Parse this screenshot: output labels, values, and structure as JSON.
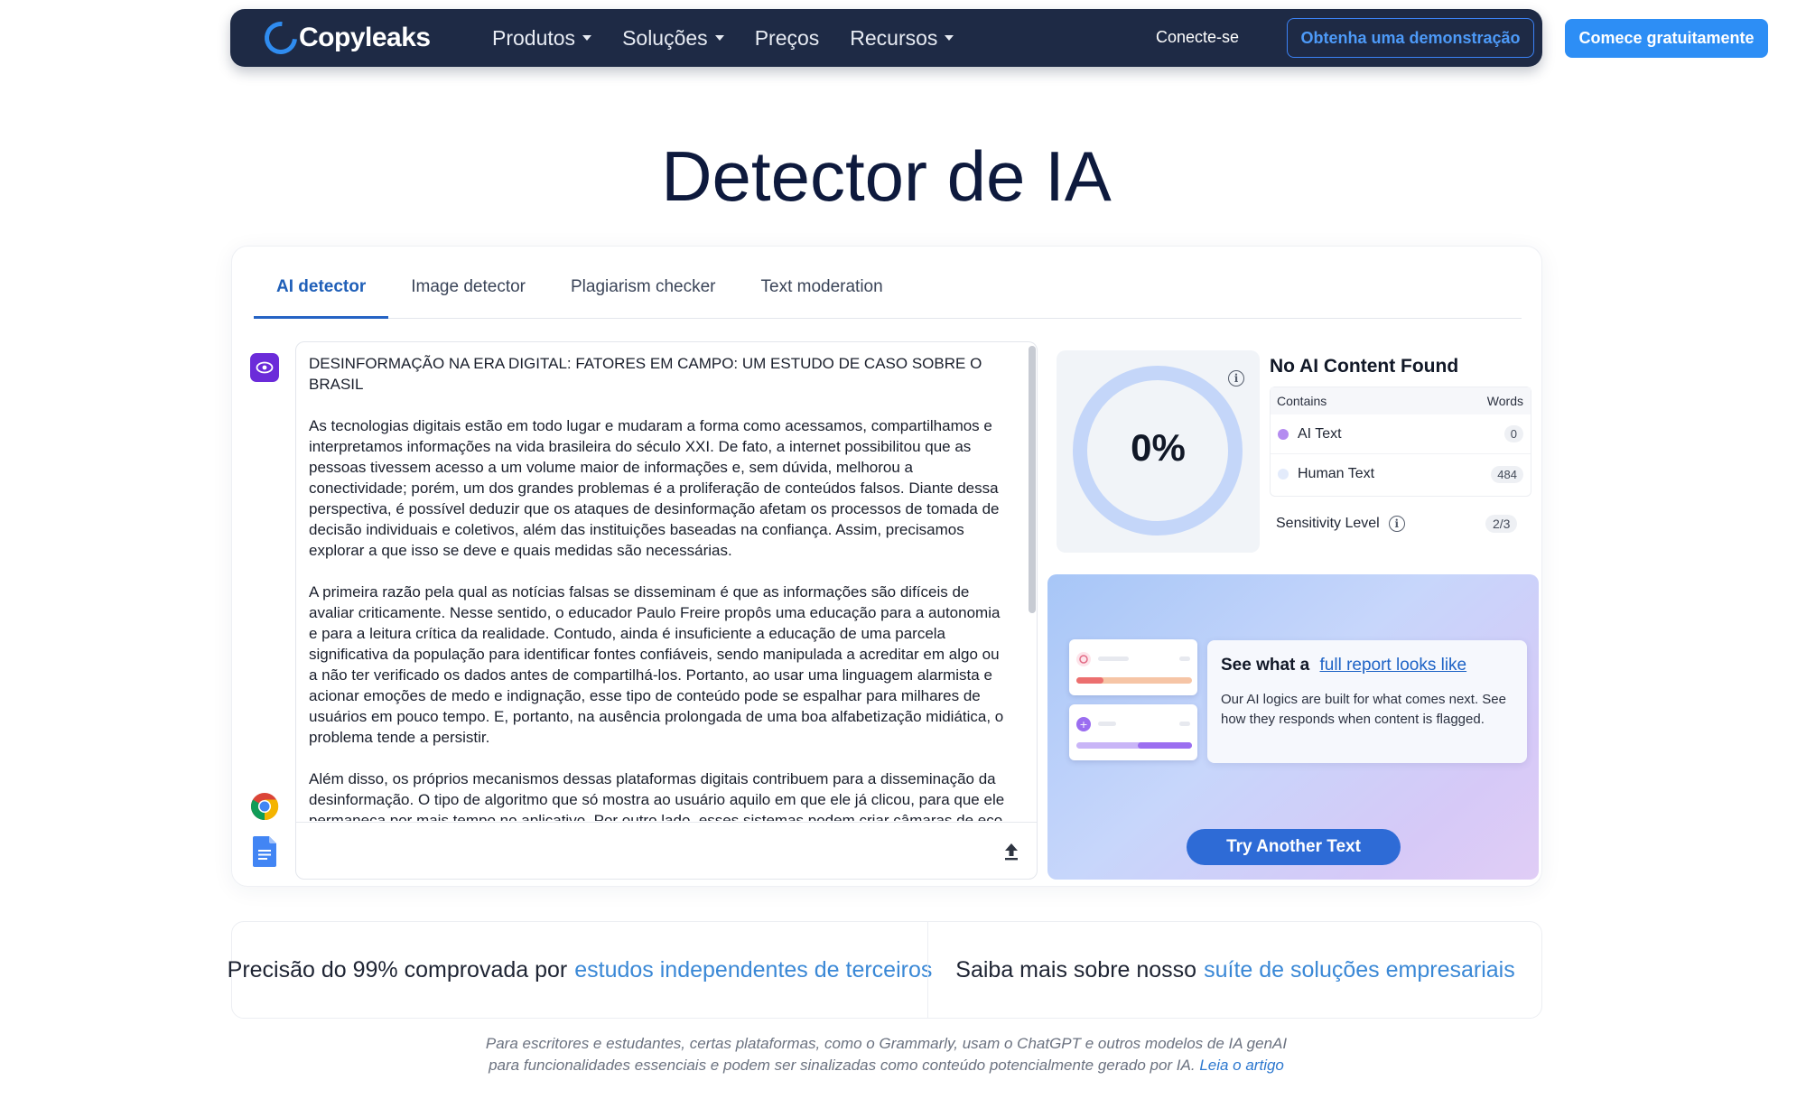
{
  "nav": {
    "logo": "Copyleaks",
    "menu": [
      {
        "label": "Produtos",
        "dropdown": true
      },
      {
        "label": "Soluções",
        "dropdown": true
      },
      {
        "label": "Preços",
        "dropdown": false
      },
      {
        "label": "Recursos",
        "dropdown": true
      }
    ],
    "login": "Conecte-se",
    "demo": "Obtenha uma demonstração",
    "start": "Comece gratuitamente"
  },
  "page_title": "Detector de IA",
  "tabs": [
    {
      "label": "AI detector",
      "active": true
    },
    {
      "label": "Image detector",
      "active": false
    },
    {
      "label": "Plagiarism checker",
      "active": false
    },
    {
      "label": "Text moderation",
      "active": false
    }
  ],
  "editor": {
    "paragraphs": [
      "DESINFORMAÇÃO NA ERA DIGITAL: FATORES EM CAMPO: UM ESTUDO DE CASO SOBRE O BRASIL",
      "As tecnologias digitais estão em todo lugar e mudaram a forma como acessamos, compartilhamos e interpretamos informações na vida brasileira do século XXI. De fato, a internet possibilitou que as pessoas tivessem acesso a um volume maior de informações e, sem dúvida, melhorou a conectividade; porém, um dos grandes problemas é a proliferação de conteúdos falsos. Diante dessa perspectiva, é possível deduzir que os ataques de desinformação afetam os processos de tomada de decisão individuais e coletivos, além das instituições baseadas na confiança. Assim, precisamos explorar a que isso se deve e quais medidas são necessárias.",
      "A primeira razão pela qual as notícias falsas se disseminam é que as informações são difíceis de avaliar criticamente. Nesse sentido, o educador Paulo Freire propôs uma educação para a autonomia e para a leitura crítica da realidade. Contudo, ainda é insuficiente a educação de uma parcela significativa da população para identificar fontes confiáveis, sendo manipulada a acreditar em algo ou a não ter verificado os dados antes de compartilhá-los. Portanto, ao usar uma linguagem alarmista e acionar emoções de medo e indignação, esse tipo de conteúdo pode se espalhar para milhares de usuários em pouco tempo. E, portanto, na ausência prolongada de uma boa alfabetização midiática, o problema tende a persistir.",
      "Além disso, os próprios mecanismos dessas plataformas digitais contribuem para a disseminação da desinformação. O tipo de algoritmo que só mostra ao usuário aquilo em que ele já clicou, para que ele permaneça por mais tempo no aplicativo. Por outro lado, esses sistemas podem criar câmaras de eco, nas quais certas mensagens são recicladas sem fim"
    ]
  },
  "result": {
    "percent": "0%",
    "title": "No AI Content Found",
    "table_headers": {
      "contains": "Contains",
      "words": "Words"
    },
    "rows": [
      {
        "label": "AI Text",
        "count": "0",
        "color": "#b48cf0"
      },
      {
        "label": "Human Text",
        "count": "484",
        "color": "#e3ebfb"
      }
    ],
    "sensitivity_label": "Sensitivity Level",
    "sensitivity_value": "2/3"
  },
  "promo": {
    "heading": "See what a",
    "link": "full report looks like",
    "body": "Our AI logics are built for what comes next. See how they responds when content is flagged.",
    "button": "Try Another Text"
  },
  "strip": {
    "left_text": "Precisão do 99% comprovada por",
    "left_link": "estudos independentes de terceiros",
    "right_text": "Saiba mais sobre nosso",
    "right_link": "suíte de soluções empresariais"
  },
  "footnote": {
    "line1": "Para escritores e estudantes, certas plataformas, como o Grammarly, usam o ChatGPT e outros modelos de IA genAI",
    "line2": "para funcionalidades essenciais e podem ser sinalizadas como conteúdo potencialmente gerado por IA.",
    "link": "Leia o artigo"
  },
  "colors": {
    "nav_bg": "#1e2a45",
    "brand_blue": "#2d8ef5",
    "tab_active": "#1f5fb8",
    "button_blue": "#2e6bd6"
  }
}
